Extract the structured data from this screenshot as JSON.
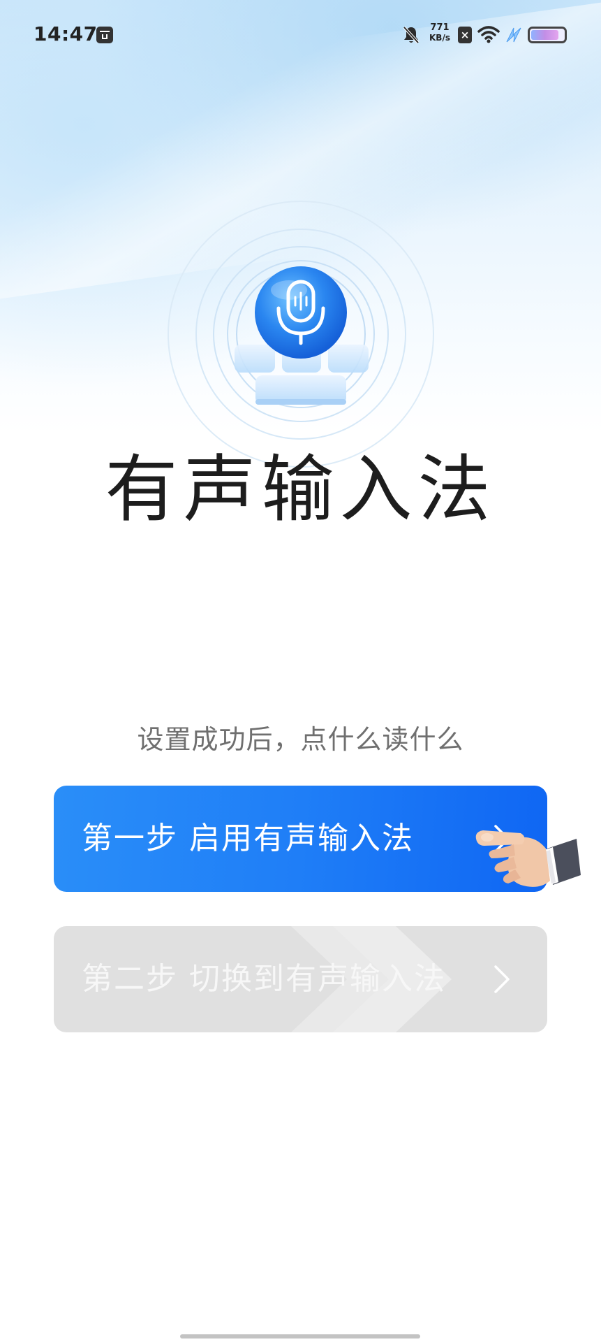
{
  "status_bar": {
    "time": "14:47",
    "net_speed_value": "771",
    "net_speed_unit": "KB/s",
    "sim_label": "×",
    "battery_level": 0.85,
    "icons": [
      "app-notification-icon",
      "bell-off-icon",
      "sim-icon",
      "wifi-icon",
      "charging-icon",
      "battery-icon"
    ]
  },
  "hero": {
    "icon": "microphone-keyboard-logo",
    "title": "有声输入法"
  },
  "subtitle": "设置成功后，点什么读什么",
  "steps": [
    {
      "label": "第一步 启用有声输入法",
      "state": "active",
      "icon": "chevron-right-icon"
    },
    {
      "label": "第二步 切换到有声输入法",
      "state": "disabled",
      "icon": "chevron-right-icon"
    }
  ],
  "colors": {
    "primary": "#1f7ef7",
    "disabled": "#e0e0e0",
    "title": "#1d1d1d",
    "subtitle": "#6f6f6f"
  }
}
